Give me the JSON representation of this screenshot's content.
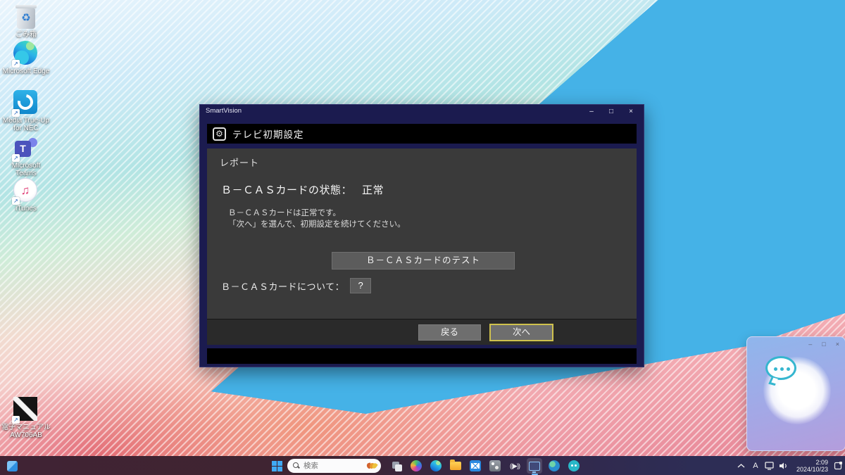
{
  "colors": {
    "wallpaper_blue": "#1697dd",
    "window_frame_navy": "#1b1b4f",
    "content_gray": "#3a3a3a",
    "focus_border_yellow": "#cfc14d",
    "taskbar_indicator_blue": "#6cb8f8"
  },
  "desktop": {
    "icons": [
      {
        "name": "recycle-bin",
        "label": "ごみ箱"
      },
      {
        "name": "microsoft-edge",
        "label": "Microsoft Edge"
      },
      {
        "name": "media-true-up",
        "label": "Media True-Up",
        "label2": "for NEC"
      },
      {
        "name": "microsoft-teams",
        "label": "Microsoft Teams"
      },
      {
        "name": "itunes",
        "label": "iTunes"
      },
      {
        "name": "e-manual",
        "label": "電子マニュアル",
        "label2": "AW706AB"
      }
    ]
  },
  "smartvision": {
    "window_title": "SmartVision",
    "controls": {
      "minimize": "–",
      "maximize": "□",
      "close": "×"
    },
    "header_title": "テレビ初期設定",
    "section_title": "レポート",
    "status_label": "Ｂ－ＣＡＳカードの状態：",
    "status_value": "正常",
    "message_line1": "Ｂ－ＣＡＳカードは正常です。",
    "message_line2": "「次へ」を選んで、初期設定を続けてください。",
    "test_button": "Ｂ－ＣＡＳカードのテスト",
    "about_label": "Ｂ－ＣＡＳカードについて：",
    "help_button": "?",
    "back_button": "戻る",
    "next_button": "次へ"
  },
  "assistant_widget": {
    "controls": {
      "minimize": "–",
      "maximize": "□",
      "close": "×"
    }
  },
  "taskbar": {
    "search": {
      "placeholder": "検索"
    },
    "tray": {
      "ime": "A",
      "time": "2:09",
      "date": "2024/10/23"
    }
  }
}
